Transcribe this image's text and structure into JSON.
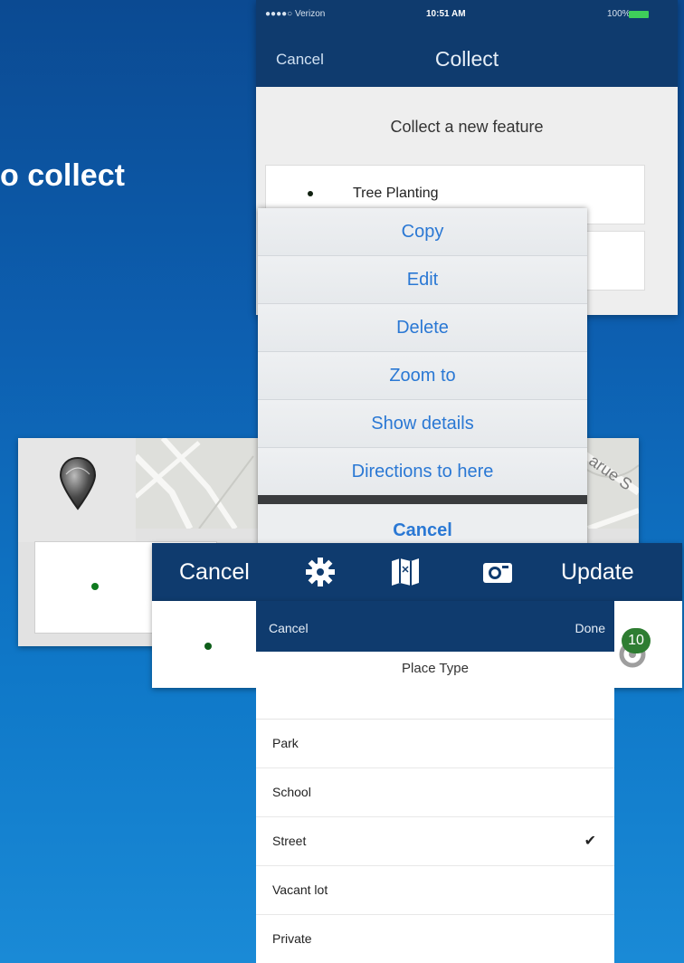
{
  "slide": {
    "title_fragment": "o collect"
  },
  "collect_screen": {
    "status": {
      "carrier": "●●●●○ Verizon",
      "time": "10:51 AM",
      "battery": "100%"
    },
    "nav": {
      "cancel_label": "Cancel",
      "title": "Collect"
    },
    "heading": "Collect a new feature",
    "feature": {
      "label": "Tree Planting"
    }
  },
  "action_sheet": {
    "items": [
      "Copy",
      "Edit",
      "Delete",
      "Zoom to",
      "Show details",
      "Directions to here"
    ],
    "cancel_label": "Cancel"
  },
  "map_panel": {
    "street_label_fragment": "arue S"
  },
  "toolbar": {
    "cancel_label": "Cancel",
    "update_label": "Update",
    "icons": [
      "gear-icon",
      "map-icon",
      "camera-icon"
    ],
    "badge_count": "10"
  },
  "picker": {
    "cancel_label": "Cancel",
    "done_label": "Done",
    "title": "Place Type",
    "options": [
      {
        "label": "Park",
        "selected": false
      },
      {
        "label": "School",
        "selected": false
      },
      {
        "label": "Street",
        "selected": true
      },
      {
        "label": "Vacant lot",
        "selected": false
      },
      {
        "label": "Private",
        "selected": false
      }
    ],
    "check_glyph": "✔"
  },
  "colors": {
    "nav_dark": "#0f3b6e",
    "ios_blue": "#2a78d4",
    "badge_green": "#2e7d32"
  }
}
